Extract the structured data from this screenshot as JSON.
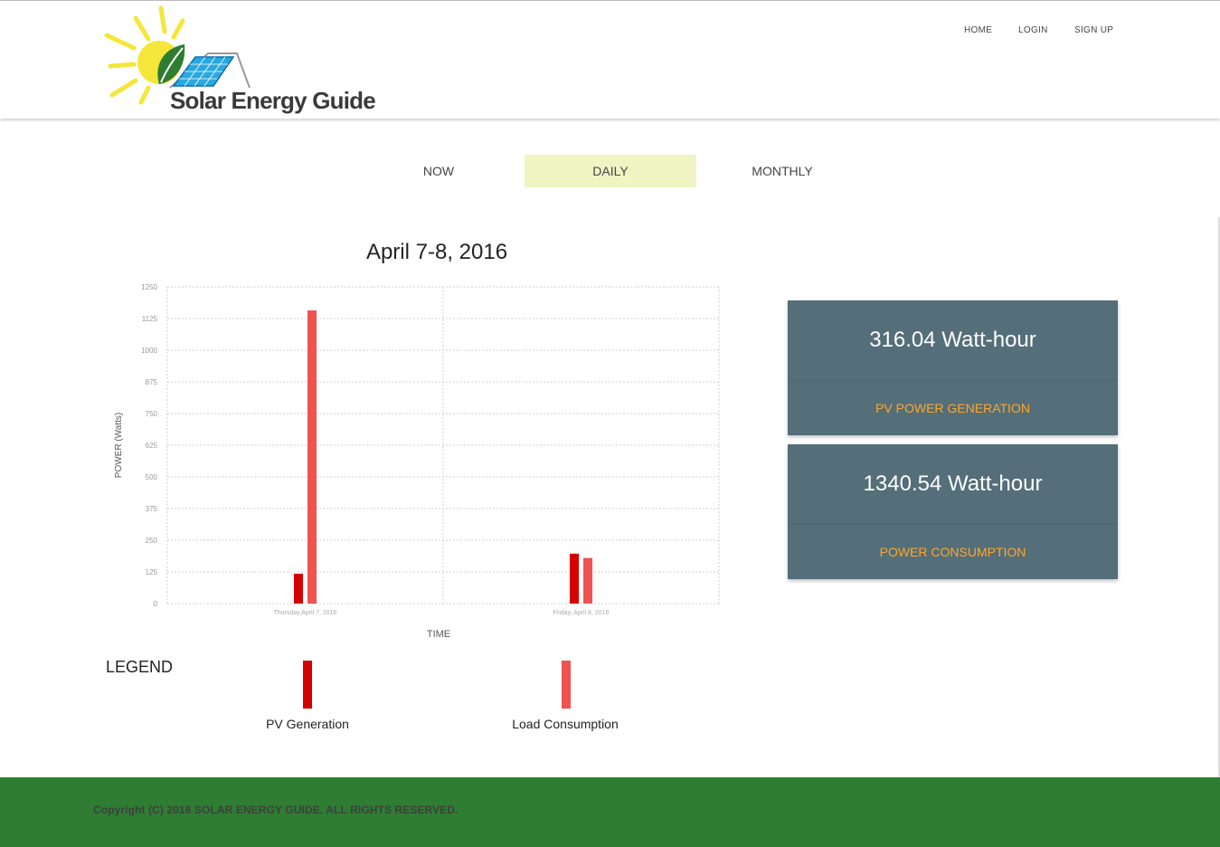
{
  "header": {
    "logo_text": "Solar Energy Guide",
    "nav": [
      {
        "label": "HOME"
      },
      {
        "label": "LOGIN"
      },
      {
        "label": "SIGN UP"
      }
    ]
  },
  "tabs": [
    {
      "label": "NOW",
      "active": false
    },
    {
      "label": "DAILY",
      "active": true
    },
    {
      "label": "MONTHLY",
      "active": false
    }
  ],
  "chart_title": "April 7-8, 2016",
  "chart_data": {
    "type": "bar",
    "title": "April 7-8, 2016",
    "xlabel": "TIME",
    "ylabel": "POWER (Watts)",
    "ylim": [
      0,
      1250
    ],
    "yticks": [
      0,
      125,
      250,
      375,
      500,
      625,
      750,
      875,
      1000,
      1125,
      1250
    ],
    "categories": [
      "Thursday,April 7, 2016",
      "Friday, April 8, 2016"
    ],
    "series": [
      {
        "name": "PV Generation",
        "color": "#d50000",
        "values": [
          118,
          197
        ]
      },
      {
        "name": "Load Consumption",
        "color": "#ef5350",
        "values": [
          1157,
          180
        ]
      }
    ],
    "grid": true
  },
  "legend": {
    "title": "LEGEND",
    "items": [
      {
        "label": "PV Generation",
        "color": "#d50000"
      },
      {
        "label": "Load Consumption",
        "color": "#ef5350"
      }
    ]
  },
  "cards": [
    {
      "value": "316.04 Watt-hour",
      "label": "PV POWER GENERATION"
    },
    {
      "value": "1340.54 Watt-hour",
      "label": "POWER CONSUMPTION"
    }
  ],
  "footer": {
    "copyright": "Copyright (C) 2016 SOLAR ENERGY GUIDE. ALL RIGHTS RESERVED."
  },
  "colors": {
    "accent_tab": "#f0f4c3",
    "card_bg": "#546e7a",
    "card_label": "#ffa726",
    "footer_bg": "#2e7d32"
  }
}
